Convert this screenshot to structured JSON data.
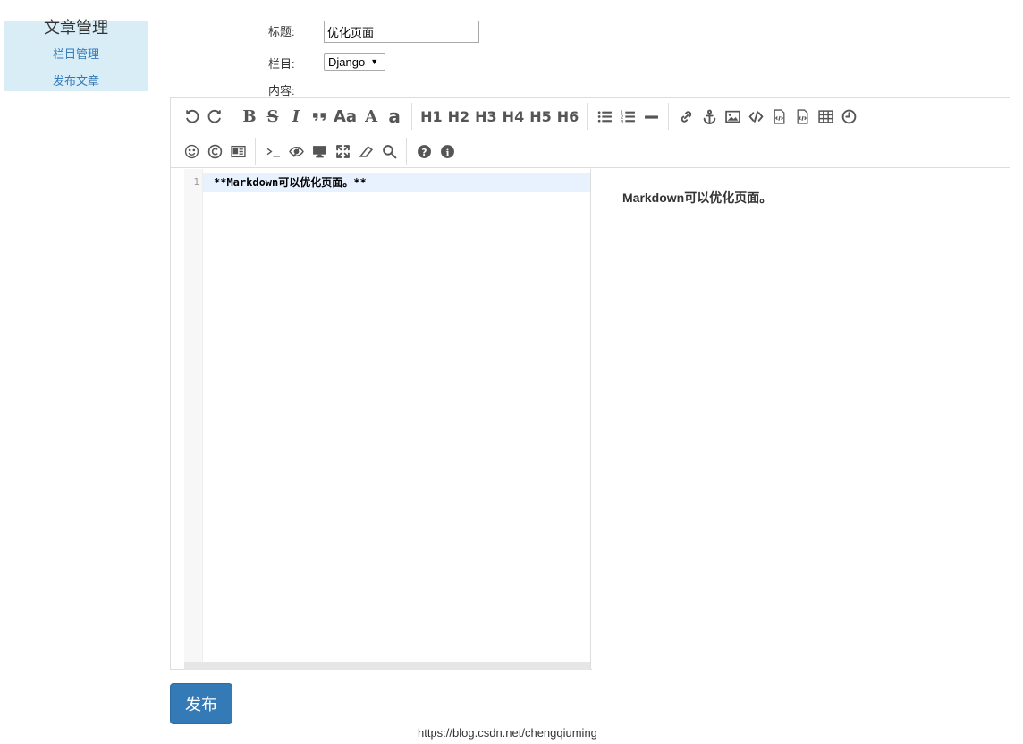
{
  "sidebar": {
    "title": "文章管理",
    "links": [
      "栏目管理",
      "发布文章"
    ]
  },
  "form": {
    "title_label": "标题:",
    "title_value": "优化页面",
    "column_label": "栏目:",
    "column_selected": "Django",
    "content_label": "内容:"
  },
  "toolbar": {
    "row1": [
      {
        "name": "undo-icon"
      },
      {
        "name": "redo-icon"
      },
      {
        "sep": true
      },
      {
        "name": "bold-button",
        "text": "B"
      },
      {
        "name": "strikethrough-button",
        "text": "S"
      },
      {
        "name": "italic-button",
        "text": "I"
      },
      {
        "name": "quote-icon"
      },
      {
        "name": "uppercase-button",
        "text": "Aa"
      },
      {
        "name": "uppercase-a-button",
        "text": "A"
      },
      {
        "name": "lowercase-a-button",
        "text": "a"
      },
      {
        "sep": true
      },
      {
        "name": "h1-button",
        "text": "H1"
      },
      {
        "name": "h2-button",
        "text": "H2"
      },
      {
        "name": "h3-button",
        "text": "H3"
      },
      {
        "name": "h4-button",
        "text": "H4"
      },
      {
        "name": "h5-button",
        "text": "H5"
      },
      {
        "name": "h6-button",
        "text": "H6"
      },
      {
        "sep": true
      },
      {
        "name": "unordered-list-icon"
      },
      {
        "name": "ordered-list-icon"
      },
      {
        "name": "horizontal-rule-icon"
      },
      {
        "sep": true
      },
      {
        "name": "link-icon"
      },
      {
        "name": "anchor-icon"
      },
      {
        "name": "image-icon"
      },
      {
        "name": "inline-code-icon"
      },
      {
        "name": "code-block-icon"
      },
      {
        "name": "preformatted-icon"
      },
      {
        "name": "table-icon"
      },
      {
        "name": "datetime-icon"
      }
    ],
    "row2": [
      {
        "name": "emoji-icon"
      },
      {
        "name": "html-entities-icon"
      },
      {
        "name": "pagebreak-icon"
      },
      {
        "sep": true
      },
      {
        "name": "watch-icon"
      },
      {
        "name": "unwatch-icon"
      },
      {
        "name": "preview-icon"
      },
      {
        "name": "fullscreen-icon"
      },
      {
        "name": "clear-icon"
      },
      {
        "name": "search-icon"
      },
      {
        "sep": true
      },
      {
        "name": "help-icon"
      },
      {
        "name": "info-icon"
      }
    ]
  },
  "editor": {
    "line_number": "1",
    "code": "**Markdown可以优化页面。**",
    "preview": "Markdown可以优化页面。"
  },
  "publish_label": "发布",
  "watermark": "https://blog.csdn.net/chengqiuming"
}
